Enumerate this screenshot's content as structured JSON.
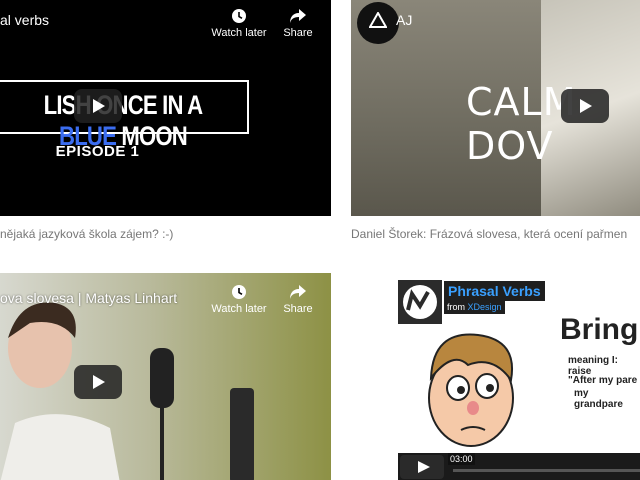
{
  "cards": [
    {
      "video_title": "al verbs",
      "watch_later": "Watch later",
      "share": "Share",
      "thumb_title_part1": "LISH ONCE IN A ",
      "thumb_title_blue": "BLUE",
      "thumb_title_part2": " MOON",
      "episode": "EPISODE 1",
      "caption": "nějaká jazyková škola zájem? :-)"
    },
    {
      "channel_name": "AJ",
      "thumb_text": "CALM DOV",
      "caption": "Daniel Štorek: Frázová slovesa, která ocení pařmen"
    },
    {
      "video_title": "ova slovesa | Matyas Linhart",
      "watch_later": "Watch later",
      "share": "Share"
    },
    {
      "series_title": "Phrasal Verbs",
      "from_label": "from ",
      "from_brand": "XDesign",
      "word": "Bring",
      "meaning": "meaning I: raise",
      "quote_line1": "\"After my pare",
      "quote_line2": "my grandpare",
      "time": "03:00"
    }
  ],
  "colors": {
    "accent_blue": "#3b6df0",
    "caption_gray": "#777777"
  }
}
